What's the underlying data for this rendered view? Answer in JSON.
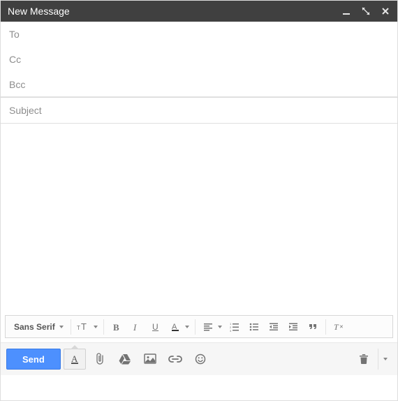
{
  "header": {
    "title": "New Message"
  },
  "fields": {
    "to_label": "To",
    "cc_label": "Cc",
    "bcc_label": "Bcc",
    "subject_placeholder": "Subject"
  },
  "format_toolbar": {
    "font_label": "Sans Serif"
  },
  "actions": {
    "send_label": "Send"
  }
}
